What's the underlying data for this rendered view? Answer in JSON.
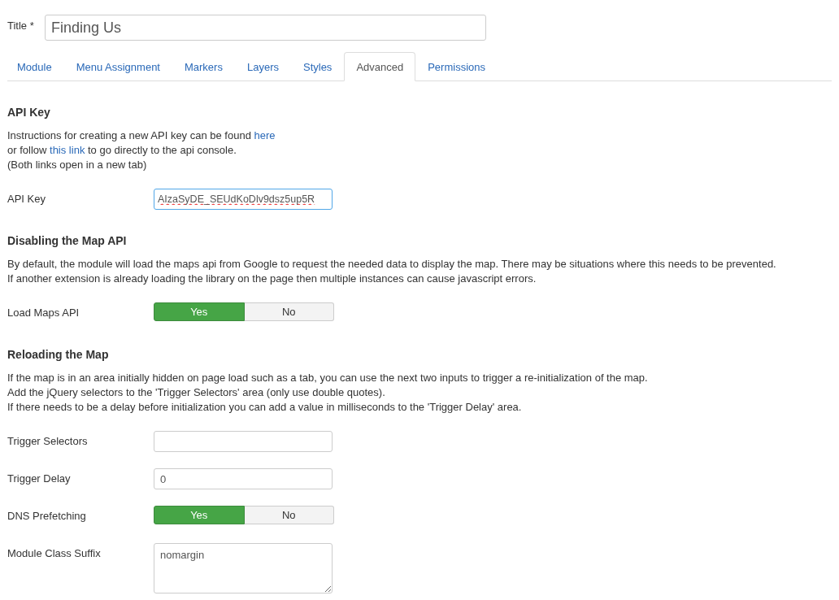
{
  "title": {
    "label": "Title *",
    "value": "Finding Us"
  },
  "tabs": [
    {
      "label": "Module",
      "selected": false
    },
    {
      "label": "Menu Assignment",
      "selected": false
    },
    {
      "label": "Markers",
      "selected": false
    },
    {
      "label": "Layers",
      "selected": false
    },
    {
      "label": "Styles",
      "selected": false
    },
    {
      "label": "Advanced",
      "selected": true
    },
    {
      "label": "Permissions",
      "selected": false
    }
  ],
  "sections": [
    {
      "heading": "API Key",
      "lines": [
        [
          {
            "kind": "text",
            "text": "Instructions for creating a new API key can be found "
          },
          {
            "kind": "link",
            "text": "here"
          }
        ],
        [
          {
            "kind": "text",
            "text": "or follow "
          },
          {
            "kind": "link",
            "text": "this link"
          },
          {
            "kind": "text",
            "text": " to go directly to the api console."
          }
        ],
        [
          {
            "kind": "text",
            "text": "(Both links open in a new tab)"
          }
        ]
      ],
      "fields": [
        {
          "label": "API Key",
          "kind": "input",
          "value": "AIzaSyDE_SEUdKoDlv9dsz5up5R",
          "misspelled": true,
          "focused": true
        }
      ]
    },
    {
      "heading": "Disabling the Map API",
      "lines": [
        [
          {
            "kind": "text",
            "text": "By default, the module will load the maps api from Google to request the needed data to display the map. There may be situations where this needs to be prevented."
          }
        ],
        [
          {
            "kind": "text",
            "text": "If another extension is already loading the library on the page then multiple instances can cause javascript errors."
          }
        ]
      ],
      "fields": [
        {
          "label": "Load Maps API",
          "kind": "toggle",
          "options": [
            {
              "label": "Yes",
              "selected": true
            },
            {
              "label": "No",
              "selected": false
            }
          ]
        }
      ]
    },
    {
      "heading": "Reloading the Map",
      "lines": [
        [
          {
            "kind": "text",
            "text": "If the map is in an area initially hidden on page load such as a tab, you can use the next two inputs to trigger a re-initialization of the map."
          }
        ],
        [
          {
            "kind": "text",
            "text": "Add the jQuery selectors to the 'Trigger Selectors' area (only use double quotes)."
          }
        ],
        [
          {
            "kind": "text",
            "text": "If there needs to be a delay before initialization you can add a value in milliseconds to the 'Trigger Delay' area."
          }
        ]
      ],
      "fields": [
        {
          "label": "Trigger Selectors",
          "kind": "input"
        },
        {
          "label": "Trigger Delay",
          "kind": "input",
          "value": "0"
        },
        {
          "label": "DNS Prefetching",
          "kind": "toggle",
          "options": [
            {
              "label": "Yes",
              "selected": true
            },
            {
              "label": "No",
              "selected": false
            }
          ]
        },
        {
          "label": "Module Class Suffix",
          "kind": "textarea",
          "value": "nomargin"
        }
      ]
    }
  ]
}
